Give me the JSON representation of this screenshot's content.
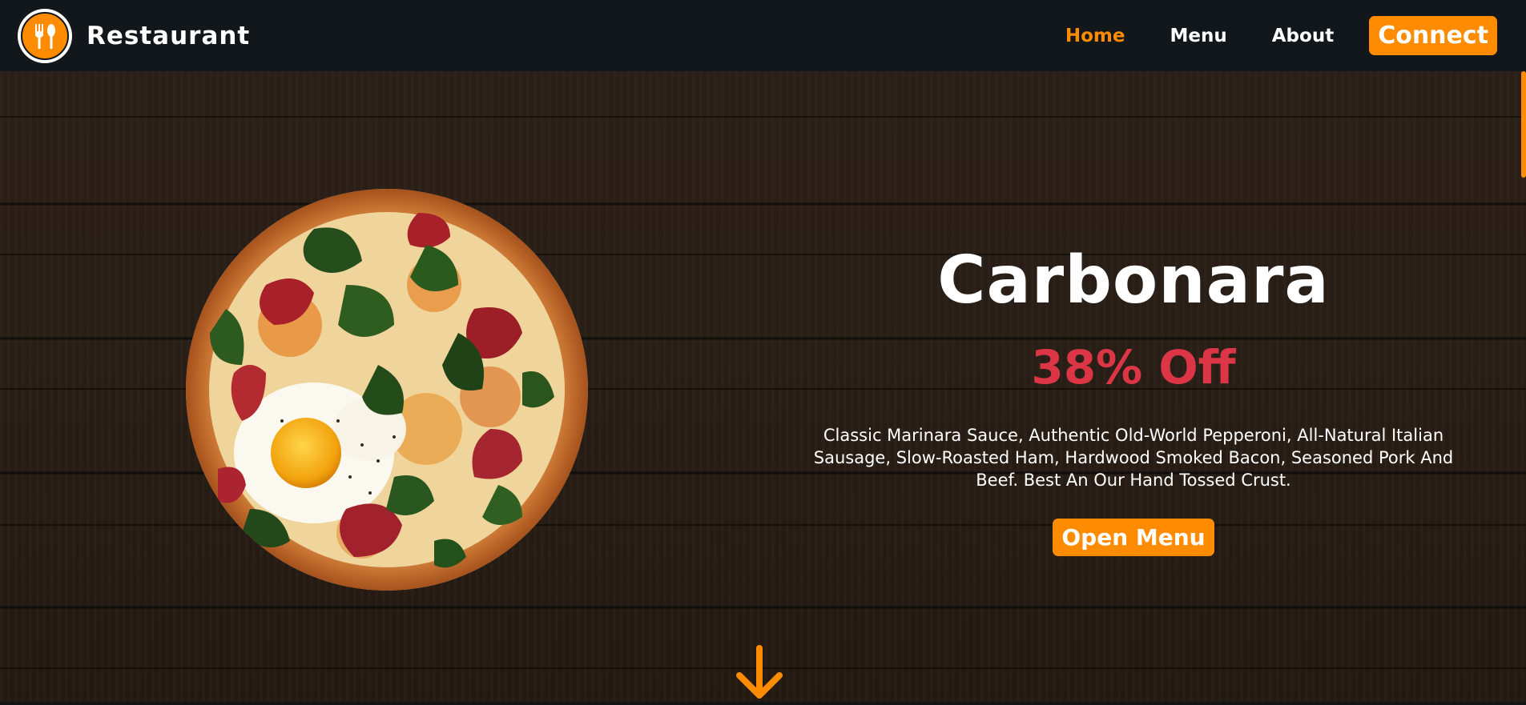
{
  "brand": {
    "name": "Restaurant",
    "logo_icon": "fork-spoon-icon"
  },
  "nav": {
    "items": [
      {
        "label": "Home",
        "active": true
      },
      {
        "label": "Menu",
        "active": false
      },
      {
        "label": "About",
        "active": false
      }
    ],
    "connect_label": "Connect"
  },
  "hero": {
    "title": "Carbonara",
    "discount": "38% Off",
    "description": "Classic Marinara Sauce, Authentic Old-World Pepperoni, All-Natural Italian Sausage, Slow-Roasted Ham, Hardwood Smoked Bacon, Seasoned Pork And Beef. Best An Our Hand Tossed Crust.",
    "button_label": "Open Menu",
    "image_subject": "pizza-with-egg-spinach-prosciutto",
    "scroll_icon": "arrow-down-icon"
  },
  "colors": {
    "accent": "#ff8c00",
    "discount": "#dc3545",
    "navbar_bg": "#12171b",
    "wood": "#2a1f17"
  }
}
